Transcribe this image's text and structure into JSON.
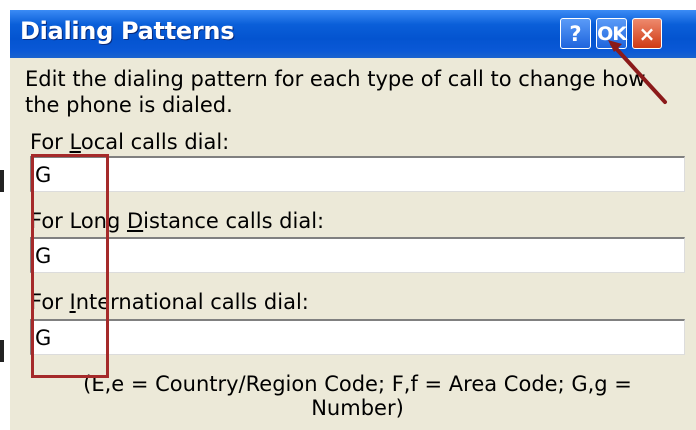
{
  "window": {
    "title": "Dialing Patterns",
    "buttons": {
      "help": "?",
      "ok": "OK",
      "close": "×"
    }
  },
  "instructions": {
    "line1": "Edit the dialing pattern for each type of call to change how",
    "line2": "the phone is dialed."
  },
  "fields": {
    "local": {
      "label_pre": "For ",
      "label_key": "L",
      "label_post": "ocal calls dial:",
      "value": "G"
    },
    "long_distance": {
      "label_pre": "For Long ",
      "label_key": "D",
      "label_post": "istance calls dial:",
      "value": "G"
    },
    "international": {
      "label_pre": "For ",
      "label_key": "I",
      "label_post": "nternational calls dial:",
      "value": "G"
    }
  },
  "note": {
    "line1": "(E,e = Country/Region Code; F,f = Area Code; G,g =",
    "line2": "Number)"
  },
  "colors": {
    "titlebar": "#0454d0",
    "dialog_bg": "#ece9d8",
    "annotation": "#a52a2a",
    "close_button": "#cf3a14"
  },
  "annotations": {
    "highlight_box": "red-rectangle",
    "pointer": "red-arrow"
  }
}
